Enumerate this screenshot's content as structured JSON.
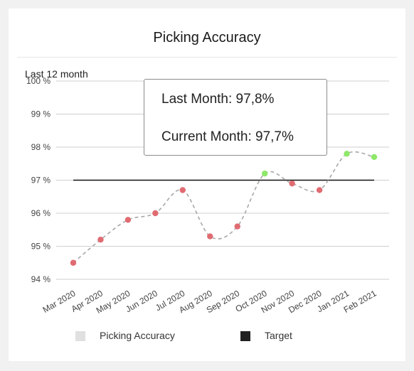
{
  "card": {
    "title": "Picking Accuracy",
    "subtitle": "Last 12 month"
  },
  "tooltip": {
    "last_month": "Last Month: 97,8%",
    "current_month": "Current Month: 97,7%"
  },
  "legend": [
    {
      "label": "Picking Accuracy",
      "color": "#e0e0e0"
    },
    {
      "label": "Target",
      "color": "#222222"
    }
  ],
  "colors": {
    "below_target": "#e06b72",
    "above_target": "#8ee86a",
    "line": "#a8a8a8",
    "target_line": "#111111",
    "grid": "#cfcfcf"
  },
  "chart_data": {
    "type": "line",
    "title": "Picking Accuracy",
    "subtitle": "Last 12 month",
    "categories": [
      "Mar 2020",
      "Apr 2020",
      "May 2020",
      "Jun 2020",
      "Jul 2020",
      "Aug 2020",
      "Sep 2020",
      "Oct 2020",
      "Nov 2020",
      "Dec 2020",
      "Jan 2021",
      "Feb 2021"
    ],
    "y_tick_labels": [
      "94 %",
      "95 %",
      "96 %",
      "97 %",
      "98 %",
      "99 %",
      "100 %"
    ],
    "ylim": [
      94,
      100
    ],
    "series": [
      {
        "name": "Picking Accuracy",
        "values": [
          94.5,
          95.2,
          95.8,
          96.0,
          96.7,
          95.3,
          95.6,
          97.2,
          96.9,
          96.7,
          97.8,
          97.7
        ]
      },
      {
        "name": "Target",
        "values": [
          97,
          97,
          97,
          97,
          97,
          97,
          97,
          97,
          97,
          97,
          97,
          97
        ]
      }
    ],
    "grid": true,
    "legend_position": "bottom"
  }
}
